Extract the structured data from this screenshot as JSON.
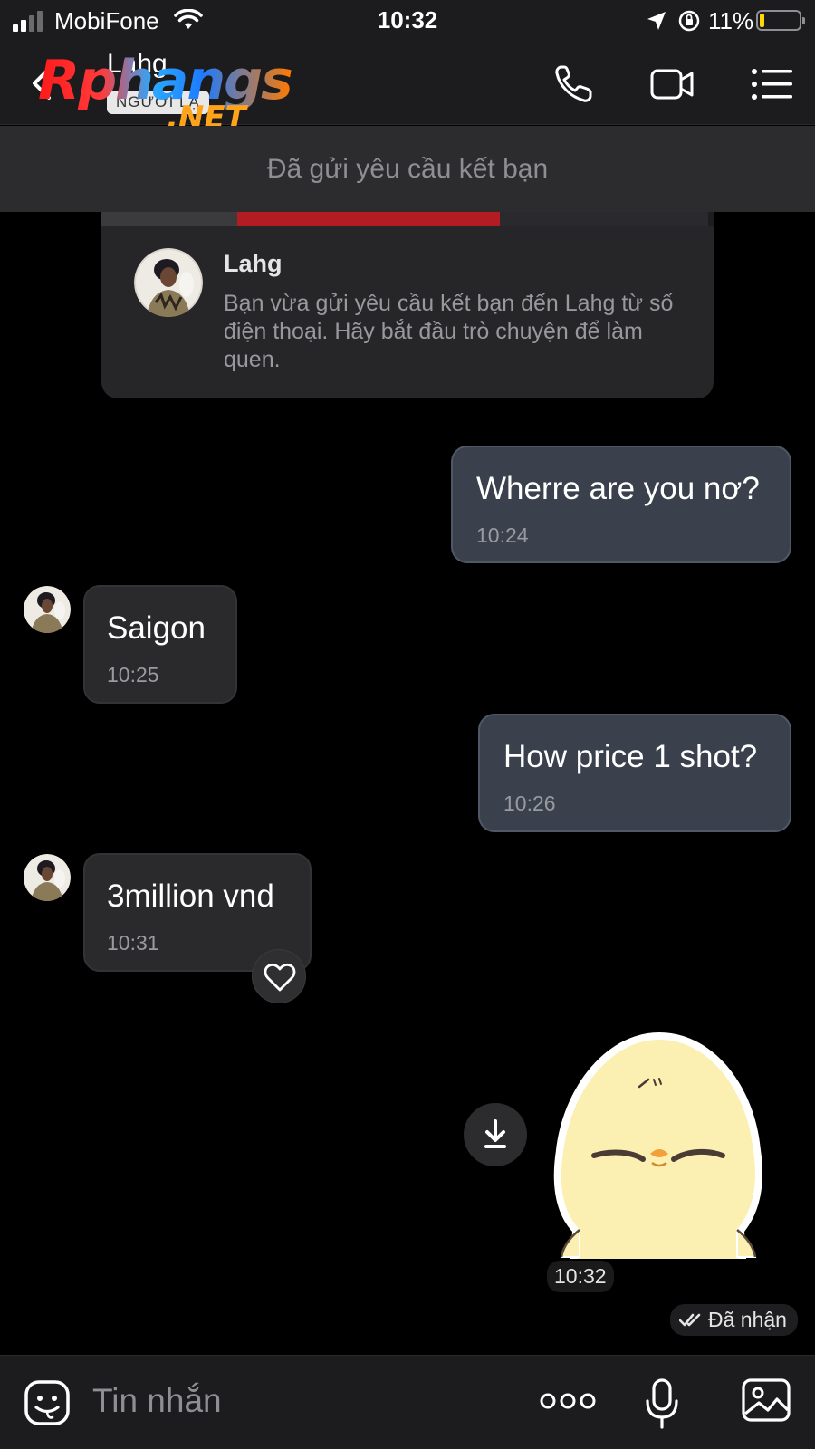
{
  "status_bar": {
    "carrier": "MobiFone",
    "time": "10:32",
    "battery_percent": "11%",
    "battery_level": 0.11
  },
  "header": {
    "contact_name": "Lahg",
    "contact_tag": "NGƯỜI LẠ",
    "watermark_main": "Rphangs",
    "watermark_sub": ".NET",
    "icons": [
      "back-icon",
      "phone-icon",
      "video-call-icon",
      "menu-icon"
    ]
  },
  "banner": {
    "text": "Đã gửi yêu cầu kết bạn"
  },
  "intro_card": {
    "name": "Lahg",
    "description": "Bạn vừa gửi yêu cầu kết bạn đến Lahg từ số điện thoại. Hãy bắt đầu trò chuyện để làm quen."
  },
  "messages": [
    {
      "direction": "out",
      "text": "Wherre are you nơ?",
      "time": "10:24"
    },
    {
      "direction": "in",
      "text": "Saigon",
      "time": "10:25"
    },
    {
      "direction": "out",
      "text": "How price 1 shot?",
      "time": "10:26"
    },
    {
      "direction": "in",
      "text": "3million vnd",
      "time": "10:31"
    },
    {
      "direction": "out",
      "type": "sticker",
      "time": "10:32"
    }
  ],
  "delivery_status": "Đã nhận",
  "input": {
    "placeholder": "Tin nhắn"
  },
  "colors": {
    "outgoing_bubble": "#3a414c",
    "incoming_bubble": "#2a2a2c",
    "background": "#000000",
    "bar": "#1c1c1e"
  }
}
